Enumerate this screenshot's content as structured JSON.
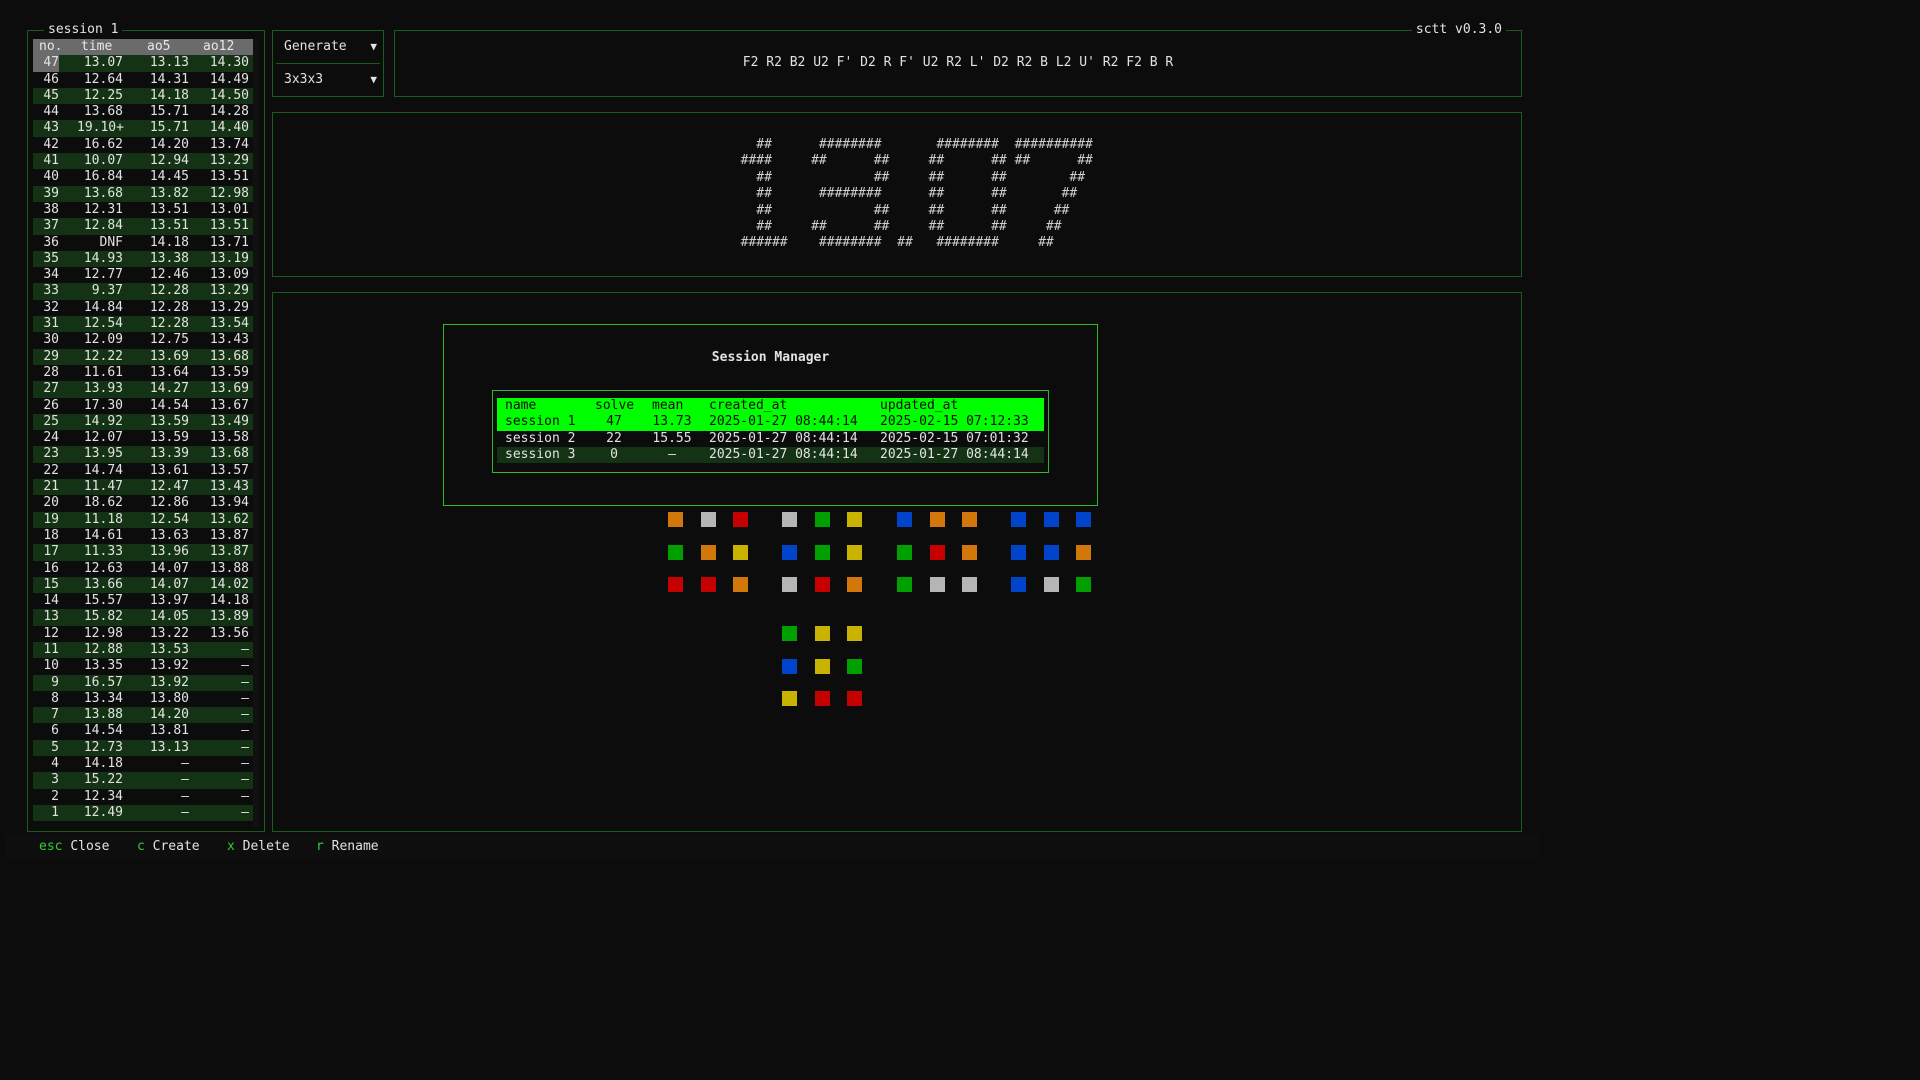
{
  "app": {
    "version": "sctt v0.3.0"
  },
  "times_panel": {
    "title": "session 1",
    "headers": {
      "no": "no.",
      "time": "time",
      "ao5": "ao5",
      "ao12": "ao12"
    },
    "rows": [
      [
        "47",
        "13.07",
        "13.13",
        "14.30"
      ],
      [
        "46",
        "12.64",
        "14.31",
        "14.49"
      ],
      [
        "45",
        "12.25",
        "14.18",
        "14.50"
      ],
      [
        "44",
        "13.68",
        "15.71",
        "14.28"
      ],
      [
        "43",
        "19.10+",
        "15.71",
        "14.40"
      ],
      [
        "42",
        "16.62",
        "14.20",
        "13.74"
      ],
      [
        "41",
        "10.07",
        "12.94",
        "13.29"
      ],
      [
        "40",
        "16.84",
        "14.45",
        "13.51"
      ],
      [
        "39",
        "13.68",
        "13.82",
        "12.98"
      ],
      [
        "38",
        "12.31",
        "13.51",
        "13.01"
      ],
      [
        "37",
        "12.84",
        "13.51",
        "13.51"
      ],
      [
        "36",
        "DNF",
        "14.18",
        "13.71"
      ],
      [
        "35",
        "14.93",
        "13.38",
        "13.19"
      ],
      [
        "34",
        "12.77",
        "12.46",
        "13.09"
      ],
      [
        "33",
        "9.37",
        "12.28",
        "13.29"
      ],
      [
        "32",
        "14.84",
        "12.28",
        "13.29"
      ],
      [
        "31",
        "12.54",
        "12.28",
        "13.54"
      ],
      [
        "30",
        "12.09",
        "12.75",
        "13.43"
      ],
      [
        "29",
        "12.22",
        "13.69",
        "13.68"
      ],
      [
        "28",
        "11.61",
        "13.64",
        "13.59"
      ],
      [
        "27",
        "13.93",
        "14.27",
        "13.69"
      ],
      [
        "26",
        "17.30",
        "14.54",
        "13.67"
      ],
      [
        "25",
        "14.92",
        "13.59",
        "13.49"
      ],
      [
        "24",
        "12.07",
        "13.59",
        "13.58"
      ],
      [
        "23",
        "13.95",
        "13.39",
        "13.68"
      ],
      [
        "22",
        "14.74",
        "13.61",
        "13.57"
      ],
      [
        "21",
        "11.47",
        "12.47",
        "13.43"
      ],
      [
        "20",
        "18.62",
        "12.86",
        "13.94"
      ],
      [
        "19",
        "11.18",
        "12.54",
        "13.62"
      ],
      [
        "18",
        "14.61",
        "13.63",
        "13.87"
      ],
      [
        "17",
        "11.33",
        "13.96",
        "13.87"
      ],
      [
        "16",
        "12.63",
        "14.07",
        "13.88"
      ],
      [
        "15",
        "13.66",
        "14.07",
        "14.02"
      ],
      [
        "14",
        "15.57",
        "13.97",
        "14.18"
      ],
      [
        "13",
        "15.82",
        "14.05",
        "13.89"
      ],
      [
        "12",
        "12.98",
        "13.22",
        "13.56"
      ],
      [
        "11",
        "12.88",
        "13.53",
        "–"
      ],
      [
        "10",
        "13.35",
        "13.92",
        "–"
      ],
      [
        "9",
        "16.57",
        "13.92",
        "–"
      ],
      [
        "8",
        "13.34",
        "13.80",
        "–"
      ],
      [
        "7",
        "13.88",
        "14.20",
        "–"
      ],
      [
        "6",
        "14.54",
        "13.81",
        "–"
      ],
      [
        "5",
        "12.73",
        "13.13",
        "–"
      ],
      [
        "4",
        "14.18",
        "–",
        "–"
      ],
      [
        "3",
        "15.22",
        "–",
        "–"
      ],
      [
        "2",
        "12.34",
        "–",
        "–"
      ],
      [
        "1",
        "12.49",
        "–",
        "–"
      ]
    ]
  },
  "dropdowns": {
    "mode": {
      "label": "Generate",
      "arrow": "▼"
    },
    "puzzle": {
      "label": "3x3x3",
      "arrow": "▼"
    }
  },
  "scramble": "F2 R2 B2 U2 F' D2 R F' U2 R2 L' D2 R2 B L2 U' R2 F2 B R",
  "timer_display": "    ##      ########       ########  ##########\n  ####     ##      ##     ##      ## ##      ##\n    ##             ##     ##      ##        ##\n    ##      ########      ##      ##       ##\n    ##             ##     ##      ##      ##\n    ##     ##      ##     ##      ##     ##\n  ######    ########  ##   ########     ##",
  "session_manager": {
    "title": "Session Manager",
    "headers": {
      "name": "name",
      "solve": "solve",
      "mean": "mean",
      "created_at": "created_at",
      "updated_at": "updated_at"
    },
    "sessions": [
      {
        "name": "session 1",
        "solve": "47",
        "mean": "13.73",
        "created_at": "2025-01-27 08:44:14",
        "updated_at": "2025-02-15 07:12:33"
      },
      {
        "name": "session 2",
        "solve": "22",
        "mean": "15.55",
        "created_at": "2025-01-27 08:44:14",
        "updated_at": "2025-02-15 07:01:32"
      },
      {
        "name": "session 3",
        "solve": "0",
        "mean": "–",
        "created_at": "2025-01-27 08:44:14",
        "updated_at": "2025-01-27 08:44:14"
      }
    ]
  },
  "cube_colors": {
    "W": "#b5b5b5",
    "Y": "#c8b400",
    "R": "#c40000",
    "O": "#d2780a",
    "G": "#00a000",
    "B": "#0044cc"
  },
  "cube_net": {
    "up": [
      "GYY",
      "BYG",
      "YRR"
    ],
    "left": [
      "OWR",
      "GOY",
      "RRO"
    ],
    "front": [
      "WGY",
      "BGY",
      "WRO"
    ],
    "right": [
      "BOO",
      "GRO",
      "GWW"
    ],
    "back": [
      "BBB",
      "BBO",
      "BWG"
    ],
    "down": [
      "GYY",
      "BYG",
      "YRR"
    ]
  },
  "footer": {
    "items": [
      {
        "key": "esc",
        "label": "Close"
      },
      {
        "key": "c",
        "label": "Create"
      },
      {
        "key": "x",
        "label": "Delete"
      },
      {
        "key": "r",
        "label": "Rename"
      }
    ]
  }
}
